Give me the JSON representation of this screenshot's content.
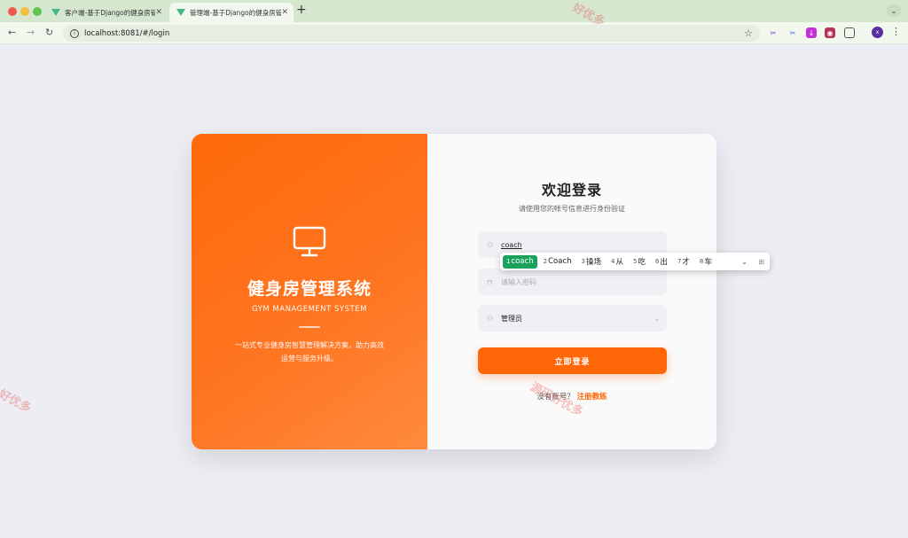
{
  "browser": {
    "tabs": [
      {
        "title": "客户端-基于Django的健身房管理系统"
      },
      {
        "title": "管理端-基于Django的健身房管理系统"
      }
    ],
    "url": "localhost:8081/#/login",
    "avatar_letter": "x"
  },
  "left_panel": {
    "title": "健身房管理系统",
    "subtitle": "GYM MANAGEMENT SYSTEM",
    "description": "一站式专业健身房智慧管理解决方案，助力高效运营与服务升级。",
    "accent_color": "#ff6a0a"
  },
  "login": {
    "title": "欢迎登录",
    "subtitle": "请使用您的帐号信息进行身份验证",
    "username_value": "coach",
    "password_placeholder": "请输入密码",
    "role_value": "管理员",
    "submit_label": "立即登录",
    "register_prompt": "没有账号？",
    "register_link": "注册教练"
  },
  "ime": {
    "candidates": [
      {
        "num": "1",
        "text": "coach"
      },
      {
        "num": "2",
        "text": "Coach"
      },
      {
        "num": "3",
        "text": "操场"
      },
      {
        "num": "4",
        "text": "从"
      },
      {
        "num": "5",
        "text": "吃"
      },
      {
        "num": "6",
        "text": "出"
      },
      {
        "num": "7",
        "text": "才"
      },
      {
        "num": "8",
        "text": "车"
      }
    ]
  },
  "watermarks": [
    "好优多",
    "源码好优多",
    "好优多"
  ]
}
